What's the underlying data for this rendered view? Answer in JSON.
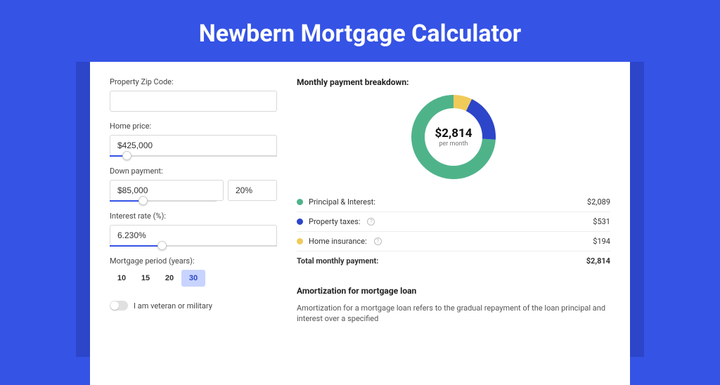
{
  "title": "Newbern Mortgage Calculator",
  "form": {
    "zip_label": "Property Zip Code:",
    "zip_value": "",
    "home_price_label": "Home price:",
    "home_price_value": "$425,000",
    "home_price_slider_pct": 10,
    "down_payment_label": "Down payment:",
    "down_payment_value": "$85,000",
    "down_payment_pct_value": "20%",
    "down_payment_slider_pct": 20,
    "interest_label": "Interest rate (%):",
    "interest_value": "6.230%",
    "interest_slider_pct": 31,
    "period_label": "Mortgage period (years):",
    "periods": [
      "10",
      "15",
      "20",
      "30"
    ],
    "period_selected": "30",
    "veteran_label": "I am veteran or military"
  },
  "breakdown": {
    "title": "Monthly payment breakdown:",
    "total_amount": "$2,814",
    "per_month": "per month",
    "items": [
      {
        "label": "Principal & Interest:",
        "value": "$2,089",
        "color": "green"
      },
      {
        "label": "Property taxes:",
        "value": "$531",
        "color": "blue",
        "help": true
      },
      {
        "label": "Home insurance:",
        "value": "$194",
        "color": "yellow",
        "help": true
      }
    ],
    "total_label": "Total monthly payment:",
    "total_value": "$2,814"
  },
  "amortization": {
    "title": "Amortization for mortgage loan",
    "text": "Amortization for a mortgage loan refers to the gradual repayment of the loan principal and interest over a specified"
  },
  "chart_data": {
    "type": "pie",
    "title": "Monthly payment breakdown",
    "series": [
      {
        "name": "Principal & Interest",
        "value": 2089,
        "color": "#4fb38a"
      },
      {
        "name": "Property taxes",
        "value": 531,
        "color": "#2c45c9"
      },
      {
        "name": "Home insurance",
        "value": 194,
        "color": "#f0cb5a"
      }
    ],
    "total": 2814,
    "unit": "$ per month"
  },
  "colors": {
    "primary": "#3553e5",
    "green": "#4fb38a",
    "blue": "#2c45c9",
    "yellow": "#f0cb5a"
  }
}
